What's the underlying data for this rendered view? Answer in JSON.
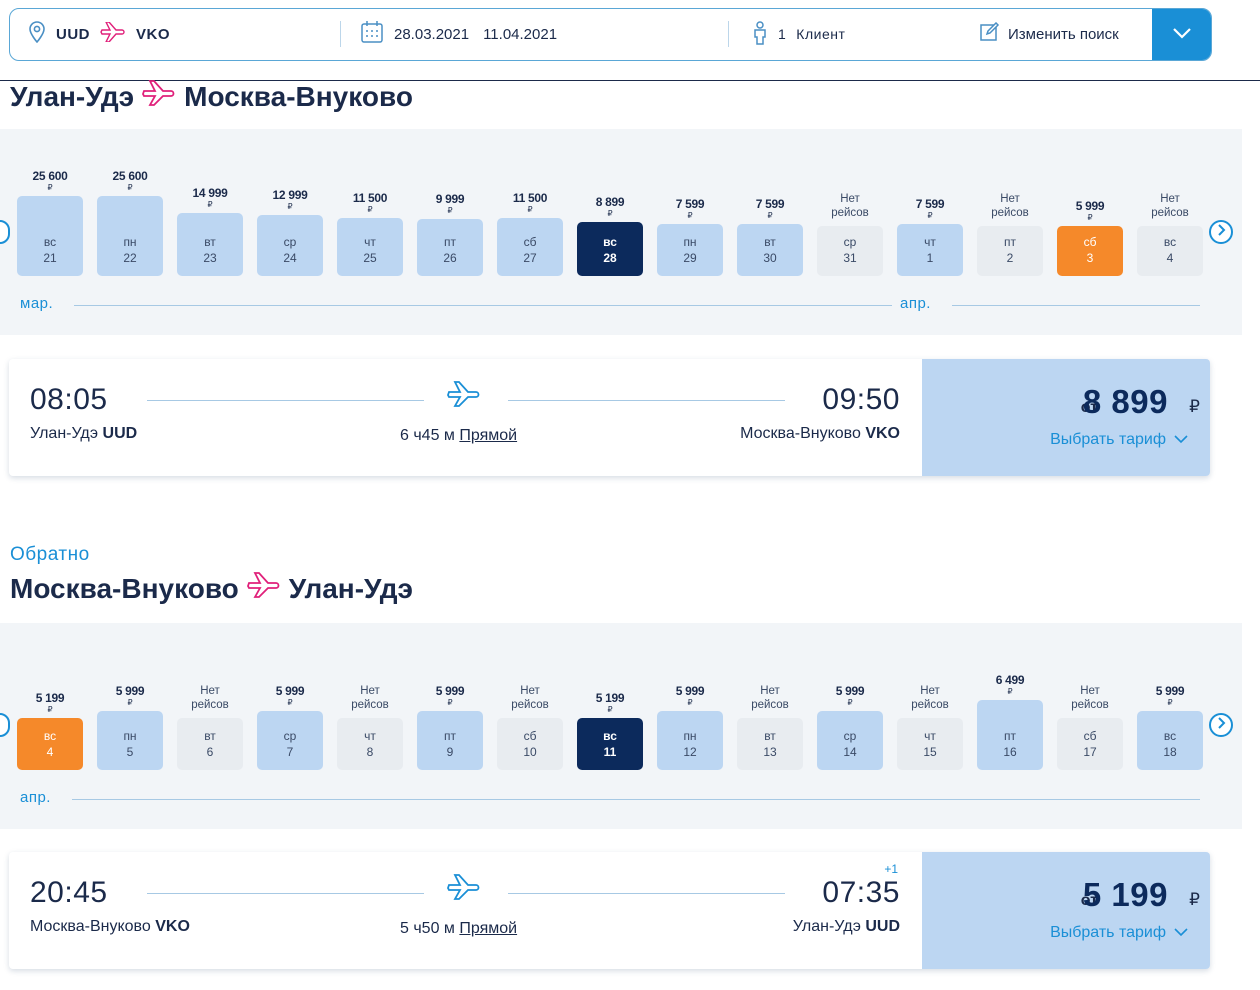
{
  "search": {
    "from": "UUD",
    "to": "VKO",
    "date_from": "28.03.2021",
    "date_to": "11.04.2021",
    "clients_count": "1",
    "clients_label": "Клиент",
    "edit_label": "Изменить поиск"
  },
  "outbound": {
    "from_city": "Улан-Удэ",
    "to_city": "Москва-Внуково",
    "days": [
      {
        "price": "25 600",
        "cur": "₽",
        "dow": "вс",
        "day": "21",
        "state": "price",
        "level": 0.97
      },
      {
        "price": "25 600",
        "cur": "₽",
        "dow": "пн",
        "day": "22",
        "state": "price",
        "level": 0.97
      },
      {
        "price": "14 999",
        "cur": "₽",
        "dow": "вт",
        "day": "23",
        "state": "price",
        "level": 0.77
      },
      {
        "price": "12 999",
        "cur": "₽",
        "dow": "ср",
        "day": "24",
        "state": "price",
        "level": 0.74
      },
      {
        "price": "11 500",
        "cur": "₽",
        "dow": "чт",
        "day": "25",
        "state": "price",
        "level": 0.71
      },
      {
        "price": "9 999",
        "cur": "₽",
        "dow": "пт",
        "day": "26",
        "state": "price",
        "level": 0.69
      },
      {
        "price": "11 500",
        "cur": "₽",
        "dow": "сб",
        "day": "27",
        "state": "price",
        "level": 0.71
      },
      {
        "price": "8 899",
        "cur": "₽",
        "dow": "вс",
        "day": "28",
        "state": "selected",
        "level": 0.66
      },
      {
        "price": "7 599",
        "cur": "₽",
        "dow": "пн",
        "day": "29",
        "state": "price",
        "level": 0.64
      },
      {
        "price": "7 599",
        "cur": "₽",
        "dow": "вт",
        "day": "30",
        "state": "price",
        "level": 0.64
      },
      {
        "price": "Нет рейсов",
        "cur": "",
        "dow": "ср",
        "day": "31",
        "state": "none",
        "level": 0.61
      },
      {
        "price": "7 599",
        "cur": "₽",
        "dow": "чт",
        "day": "1",
        "state": "price",
        "level": 0.64
      },
      {
        "price": "Нет рейсов",
        "cur": "",
        "dow": "пт",
        "day": "2",
        "state": "none",
        "level": 0.61
      },
      {
        "price": "5 999",
        "cur": "₽",
        "dow": "сб",
        "day": "3",
        "state": "cheapest",
        "level": 0.61
      },
      {
        "price": "Нет рейсов",
        "cur": "",
        "dow": "вс",
        "day": "4",
        "state": "none",
        "level": 0.61
      }
    ],
    "month_start": "мар.",
    "month_next": "апр.",
    "flight": {
      "dep_time": "08:05",
      "arr_time": "09:50",
      "dep_city": "Улан-Удэ",
      "dep_code": "UUD",
      "arr_city": "Москва-Внуково",
      "arr_code": "VKO",
      "duration": "6 ч45 м",
      "type": "Прямой",
      "next_day": "",
      "from_label": "от",
      "price": "8 899",
      "currency": "₽",
      "choose_label": "Выбрать тариф"
    }
  },
  "return": {
    "label": "Обратно",
    "from_city": "Москва-Внуково",
    "to_city": "Улан-Удэ",
    "days": [
      {
        "price": "5 199",
        "cur": "₽",
        "dow": "вс",
        "day": "4",
        "state": "cheapest",
        "level": 0.63
      },
      {
        "price": "5 999",
        "cur": "₽",
        "dow": "пн",
        "day": "5",
        "state": "price",
        "level": 0.72
      },
      {
        "price": "Нет рейсов",
        "cur": "",
        "dow": "вт",
        "day": "6",
        "state": "none",
        "level": 0.63
      },
      {
        "price": "5 999",
        "cur": "₽",
        "dow": "ср",
        "day": "7",
        "state": "price",
        "level": 0.72
      },
      {
        "price": "Нет рейсов",
        "cur": "",
        "dow": "чт",
        "day": "8",
        "state": "none",
        "level": 0.63
      },
      {
        "price": "5 999",
        "cur": "₽",
        "dow": "пт",
        "day": "9",
        "state": "price",
        "level": 0.72
      },
      {
        "price": "Нет рейсов",
        "cur": "",
        "dow": "сб",
        "day": "10",
        "state": "none",
        "level": 0.63
      },
      {
        "price": "5 199",
        "cur": "₽",
        "dow": "вс",
        "day": "11",
        "state": "selected",
        "level": 0.63
      },
      {
        "price": "5 999",
        "cur": "₽",
        "dow": "пн",
        "day": "12",
        "state": "price",
        "level": 0.72
      },
      {
        "price": "Нет рейсов",
        "cur": "",
        "dow": "вт",
        "day": "13",
        "state": "none",
        "level": 0.63
      },
      {
        "price": "5 999",
        "cur": "₽",
        "dow": "ср",
        "day": "14",
        "state": "price",
        "level": 0.72
      },
      {
        "price": "Нет рейсов",
        "cur": "",
        "dow": "чт",
        "day": "15",
        "state": "none",
        "level": 0.63
      },
      {
        "price": "6 499",
        "cur": "₽",
        "dow": "пт",
        "day": "16",
        "state": "price",
        "level": 0.85
      },
      {
        "price": "Нет рейсов",
        "cur": "",
        "dow": "сб",
        "day": "17",
        "state": "none",
        "level": 0.63
      },
      {
        "price": "5 999",
        "cur": "₽",
        "dow": "вс",
        "day": "18",
        "state": "price",
        "level": 0.72
      }
    ],
    "month_start": "апр.",
    "flight": {
      "dep_time": "20:45",
      "arr_time": "07:35",
      "dep_city": "Москва-Внуково",
      "dep_code": "VKO",
      "arr_city": "Улан-Удэ",
      "arr_code": "UUD",
      "duration": "5 ч50 м",
      "type": "Прямой",
      "next_day": "+1",
      "from_label": "от",
      "price": "5 199",
      "currency": "₽",
      "choose_label": "Выбрать тариф"
    }
  },
  "colors": {
    "accent": "#1a8fd6",
    "selected": "#0c2a5c",
    "cheapest": "#f5892a",
    "bar": "#bcd6f2",
    "no_flights": "#e8ecf0",
    "plane_icon": "#e0207a"
  }
}
